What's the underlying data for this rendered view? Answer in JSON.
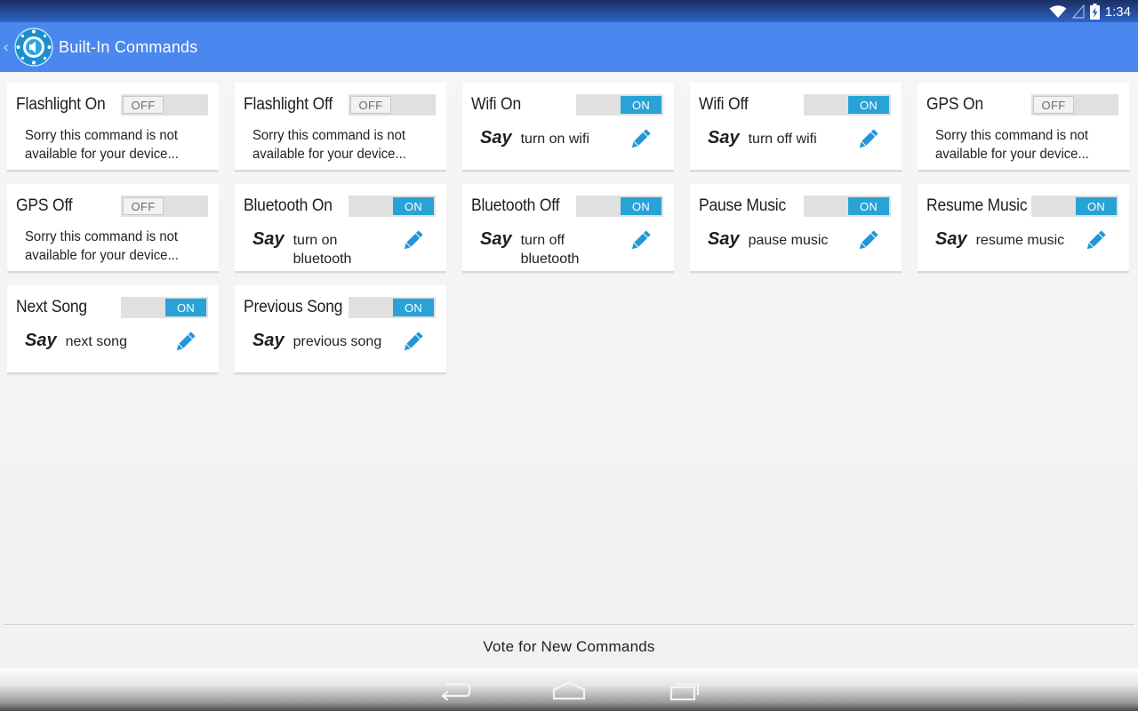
{
  "status_bar": {
    "time": "1:34"
  },
  "action_bar": {
    "title": "Built-In Commands"
  },
  "commands": [
    {
      "title": "Flashlight On",
      "toggle": "OFF",
      "unavailable": "Sorry this command is not available for your device..."
    },
    {
      "title": "Flashlight Off",
      "toggle": "OFF",
      "unavailable": "Sorry this command is not available for your device..."
    },
    {
      "title": "Wifi On",
      "toggle": "ON",
      "say": "Say",
      "phrase": "turn on wifi"
    },
    {
      "title": "Wifi Off",
      "toggle": "ON",
      "say": "Say",
      "phrase": "turn off wifi"
    },
    {
      "title": "GPS On",
      "toggle": "OFF",
      "unavailable": "Sorry this command is not available for your device..."
    },
    {
      "title": "GPS Off",
      "toggle": "OFF",
      "unavailable": "Sorry this command is not available for your device..."
    },
    {
      "title": "Bluetooth On",
      "toggle": "ON",
      "say": "Say",
      "phrase": "turn on bluetooth"
    },
    {
      "title": "Bluetooth Off",
      "toggle": "ON",
      "say": "Say",
      "phrase": "turn off bluetooth"
    },
    {
      "title": "Pause Music",
      "toggle": "ON",
      "say": "Say",
      "phrase": "pause music"
    },
    {
      "title": "Resume Music",
      "toggle": "ON",
      "say": "Say",
      "phrase": "resume music"
    },
    {
      "title": "Next Song",
      "toggle": "ON",
      "say": "Say",
      "phrase": "next song"
    },
    {
      "title": "Previous Song",
      "toggle": "ON",
      "say": "Say",
      "phrase": "previous song"
    }
  ],
  "footer": {
    "vote_label": "Vote for New Commands"
  },
  "icons": {
    "wifi": "wifi-icon",
    "signal": "signal-icon",
    "battery": "battery-charging-icon",
    "app": "voice-command-app-icon",
    "edit": "pencil-icon",
    "back": "back-icon",
    "home": "home-icon",
    "recents": "recent-apps-icon"
  },
  "colors": {
    "action_bar": "#4a87ee",
    "toggle_on": "#29a3d6",
    "pencil": "#2196d9"
  }
}
